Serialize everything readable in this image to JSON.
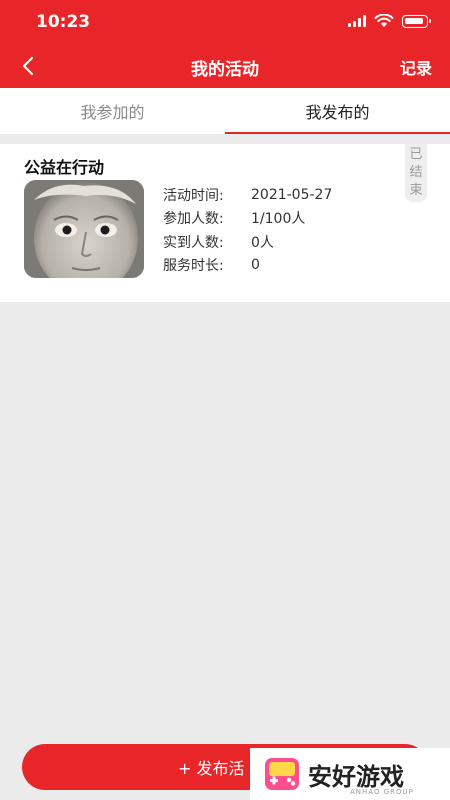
{
  "status_bar": {
    "time": "10:23"
  },
  "nav": {
    "title": "我的活动",
    "record_label": "记录"
  },
  "tabs": [
    {
      "label": "我参加的",
      "active": false
    },
    {
      "label": "我发布的",
      "active": true
    }
  ],
  "activity": {
    "title": "公益在行动",
    "status": [
      "已",
      "结",
      "束"
    ],
    "rows": [
      {
        "label": "活动时间:",
        "value": "2021-05-27"
      },
      {
        "label": "参加人数:",
        "value": "1/100人"
      },
      {
        "label": "实到人数:",
        "value": "0人"
      },
      {
        "label": "服务时长:",
        "value": "0"
      }
    ]
  },
  "publish_button": "+ 发布活",
  "watermark": {
    "text": "安好游戏",
    "sub": "ANHAO GROUP"
  },
  "colors": {
    "accent": "#e8262a",
    "background": "#ebebeb"
  }
}
